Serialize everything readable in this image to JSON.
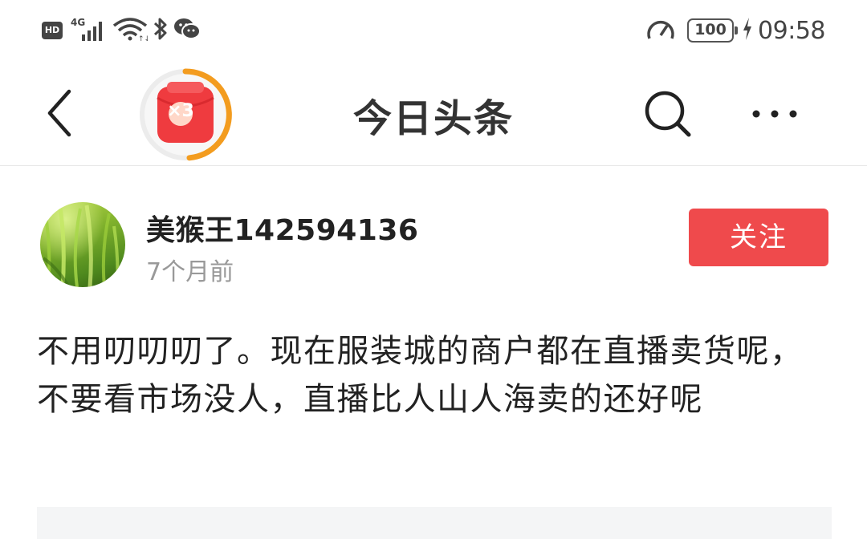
{
  "status_bar": {
    "hd": "HD",
    "network": "4G",
    "battery": "100",
    "time": "09:58"
  },
  "header": {
    "title": "今日头条",
    "reward_multiplier": "×3"
  },
  "post": {
    "author": "美猴王142594136",
    "time_ago": "7个月前",
    "follow_label": "关注",
    "body": "不用叨叨叨了。现在服装城的商户都在直播卖货呢，不要看市场没人，直播比人山人海卖的还好呢"
  },
  "colors": {
    "follow_button": "#ef4a4c",
    "reward_ring": "#f39c1f",
    "reward_box": "#ef3b3f"
  },
  "icons": [
    "back-arrow-icon",
    "reward-icon",
    "search-icon",
    "more-icon",
    "wifi-icon",
    "bluetooth-icon",
    "wechat-icon",
    "speedometer-icon",
    "charging-icon"
  ]
}
